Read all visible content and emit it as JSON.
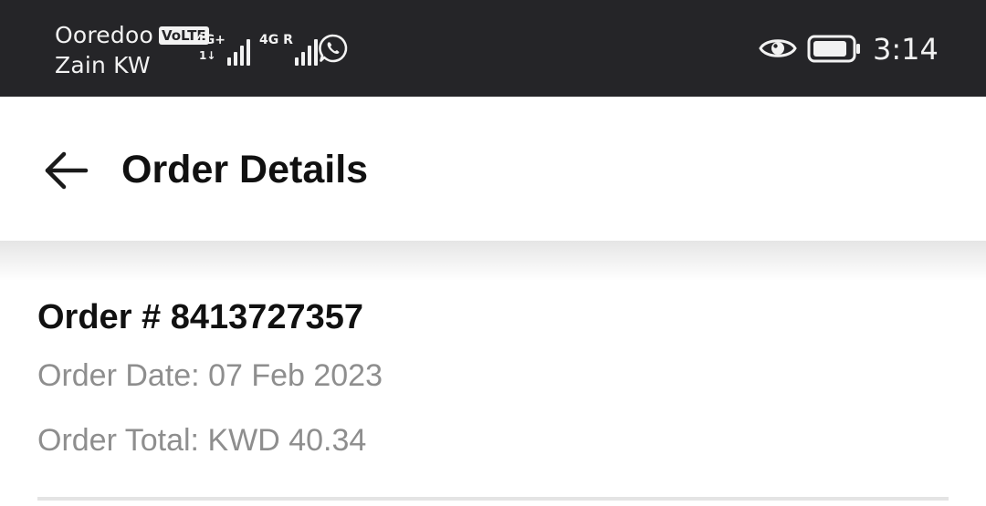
{
  "status_bar": {
    "carrier_1": "Ooredoo",
    "volte_badge": "VoLTE",
    "carrier_2": "Zain KW",
    "sim1_network": "4G+",
    "sim1_activity": "1↓",
    "sim2_network": "4G R",
    "time": "3:14",
    "icons": [
      "signal-icon",
      "whatsapp-icon",
      "eye-icon",
      "battery-icon"
    ]
  },
  "app_bar": {
    "back_icon": "back-arrow-icon",
    "title": "Order Details"
  },
  "order": {
    "number_label": "Order # 8413727357",
    "date_label": "Order Date: 07 Feb 2023",
    "total_label": "Order Total: KWD 40.34"
  },
  "colors": {
    "status_bar_bg": "#252528",
    "title_text": "#111111",
    "secondary_text": "#8e8e8e",
    "divider": "#e4e4e4"
  }
}
